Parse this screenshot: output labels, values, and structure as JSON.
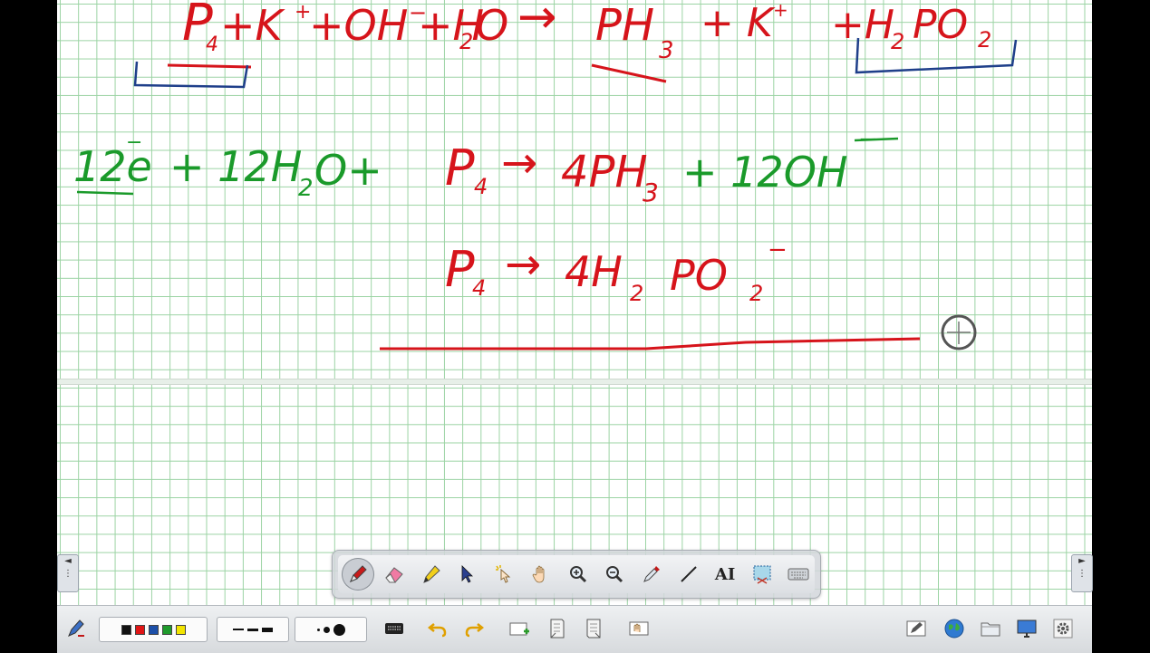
{
  "whiteboard": {
    "equations": {
      "line1": {
        "p4": "P",
        "p4_sub": "4",
        "plus_k": "+K",
        "k_charge": "+",
        "oh": "+OH",
        "oh_charge": "−",
        "h2o": "+H",
        "h2o_sub": "2",
        "h2o_o": "O",
        "arrow": "→",
        "ph3": "PH",
        "ph3_sub": "3",
        "k_right": "+ K",
        "k_right_charge": "+",
        "h2po2": "+H",
        "h2po2_sub1": "2",
        "h2po2_po": "PO",
        "h2po2_sub2": "2"
      },
      "line2": {
        "electrons": "12e",
        "electron_mark": "−",
        "water": "+ 12H",
        "water_sub": "2",
        "water_o": "O+",
        "p4": "P",
        "p4_sub": "4",
        "arrow": "→",
        "ph3": "4PH",
        "ph3_sub": "3",
        "oh": "+ 12OH",
        "oh_charge": "−"
      },
      "line3": {
        "p4": "P",
        "p4_sub": "4",
        "arrow": "→",
        "h2po2": "4H",
        "h2po2_sub1": "2",
        "h2po2_po": "PO",
        "h2po2_sub2": "2",
        "h2po2_charge": "−"
      }
    },
    "ink_colors": {
      "red": "#d6141b",
      "green": "#1a9a2a",
      "blue": "#1f3f8a",
      "black": "#222222"
    }
  },
  "side_arrows": {
    "left": "◄",
    "right": "►"
  },
  "palette": {
    "tools": [
      "pen-icon",
      "eraser-icon",
      "highlighter-icon",
      "select-arrow-icon",
      "magic-pointer-icon",
      "pan-hand-icon",
      "zoom-in-icon",
      "zoom-out-icon",
      "color-picker-icon",
      "line-icon",
      "text-recognition-icon",
      "screen-capture-icon",
      "keyboard-icon"
    ],
    "text_tool_label": "AI"
  },
  "bottom_toolbar": {
    "colors": [
      "#111111",
      "#e01515",
      "#1c4fa8",
      "#1f9a2c",
      "#f2e400"
    ],
    "icons": [
      "pen-settings-icon",
      "keyboard-icon",
      "undo-icon",
      "redo-icon",
      "new-page-icon",
      "previous-page-icon",
      "next-page-icon",
      "gesture-icon",
      "edit-icon",
      "globe-icon",
      "folder-icon",
      "display-icon",
      "settings-icon"
    ]
  }
}
